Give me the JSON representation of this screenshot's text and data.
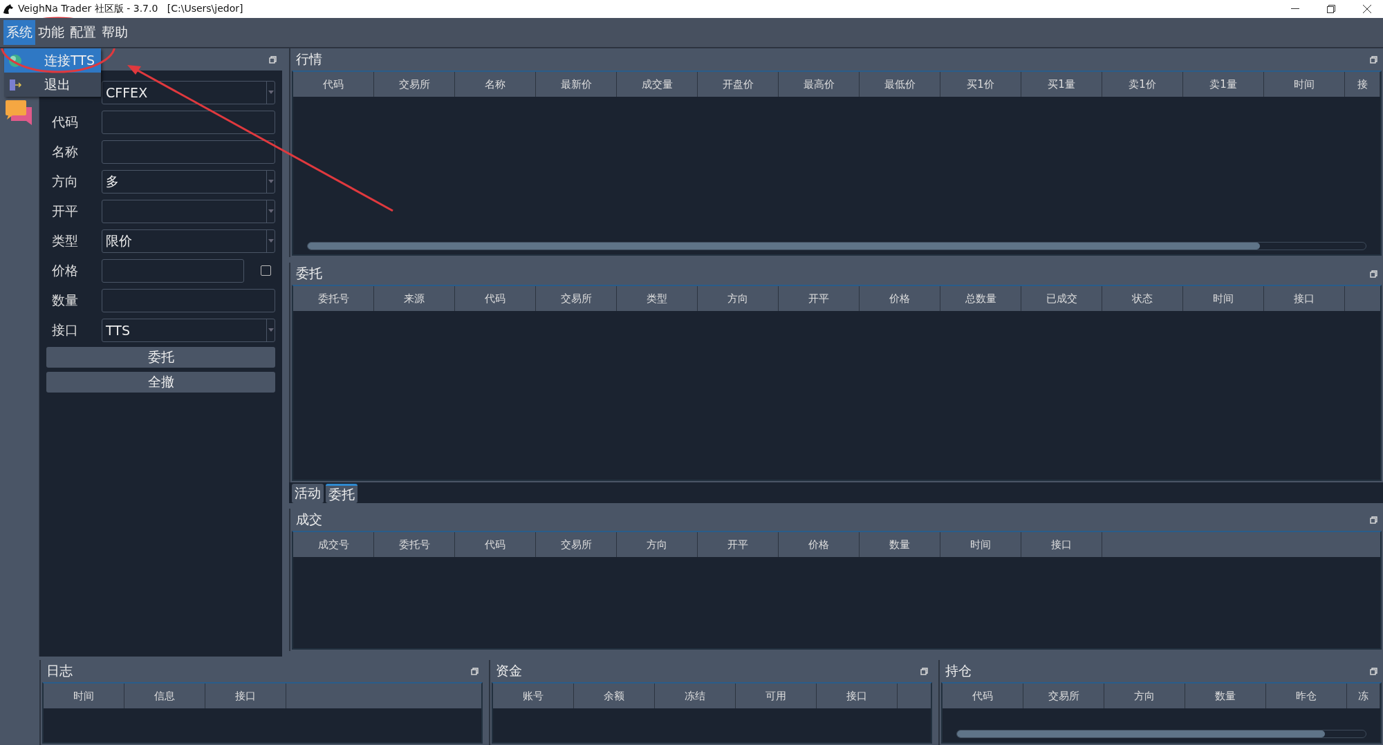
{
  "window": {
    "title": "VeighNa Trader 社区版 - 3.7.0   [C:\\Users\\jedor]"
  },
  "menu_bar": [
    {
      "label": "系统",
      "selected": true
    },
    {
      "label": "功能",
      "selected": false
    },
    {
      "label": "配置",
      "selected": false
    },
    {
      "label": "帮助",
      "selected": false
    }
  ],
  "open_menu": [
    {
      "label": "连接TTS",
      "selected": true,
      "kind": "connect"
    },
    {
      "label": "退出",
      "selected": false,
      "kind": "exit"
    }
  ],
  "trade_panel": {
    "fields": [
      {
        "kind": "select",
        "value": "CFFEX"
      },
      {
        "label": "代码",
        "kind": "input"
      },
      {
        "label": "名称",
        "kind": "input"
      },
      {
        "label": "方向",
        "kind": "select",
        "value": "多"
      },
      {
        "label": "开平",
        "kind": "select"
      },
      {
        "label": "类型",
        "kind": "select",
        "value": "限价"
      },
      {
        "label": "价格",
        "kind": "check_input",
        "checked": false
      },
      {
        "label": "数量",
        "kind": "input"
      },
      {
        "label": "接口",
        "kind": "select",
        "value": "TTS"
      }
    ],
    "buttons": [
      "委托",
      "全撤"
    ]
  },
  "market": {
    "title": "行情",
    "clipped_right": true,
    "columns": [
      "代码",
      "交易所",
      "名称",
      "最新价",
      "成交量",
      "开盘价",
      "最高价",
      "最低价",
      "买1价",
      "买1量",
      "卖1价",
      "卖1量",
      "时间",
      "接"
    ]
  },
  "orders": {
    "title": "委托",
    "clipped_right": false,
    "columns": [
      "委托号",
      "来源",
      "代码",
      "交易所",
      "类型",
      "方向",
      "开平",
      "价格",
      "总数量",
      "已成交",
      "状态",
      "时间",
      "接口"
    ]
  },
  "order_tabs": [
    {
      "label": "活动",
      "selected": false
    },
    {
      "label": "委托",
      "selected": true
    }
  ],
  "trades": {
    "title": "成交",
    "clipped_right": false,
    "columns": [
      "成交号",
      "委托号",
      "代码",
      "交易所",
      "方向",
      "开平",
      "价格",
      "数量",
      "时间",
      "接口"
    ]
  },
  "log": {
    "title": "日志",
    "clipped_right": false,
    "columns": [
      "时间",
      "信息",
      "接口"
    ]
  },
  "funds": {
    "title": "资金",
    "clipped_right": false,
    "columns": [
      "账号",
      "余额",
      "冻结",
      "可用",
      "接口"
    ]
  },
  "positions": {
    "title": "持仓",
    "clipped_right": true,
    "columns": [
      "代码",
      "交易所",
      "方向",
      "数量",
      "昨仓",
      "冻"
    ]
  }
}
